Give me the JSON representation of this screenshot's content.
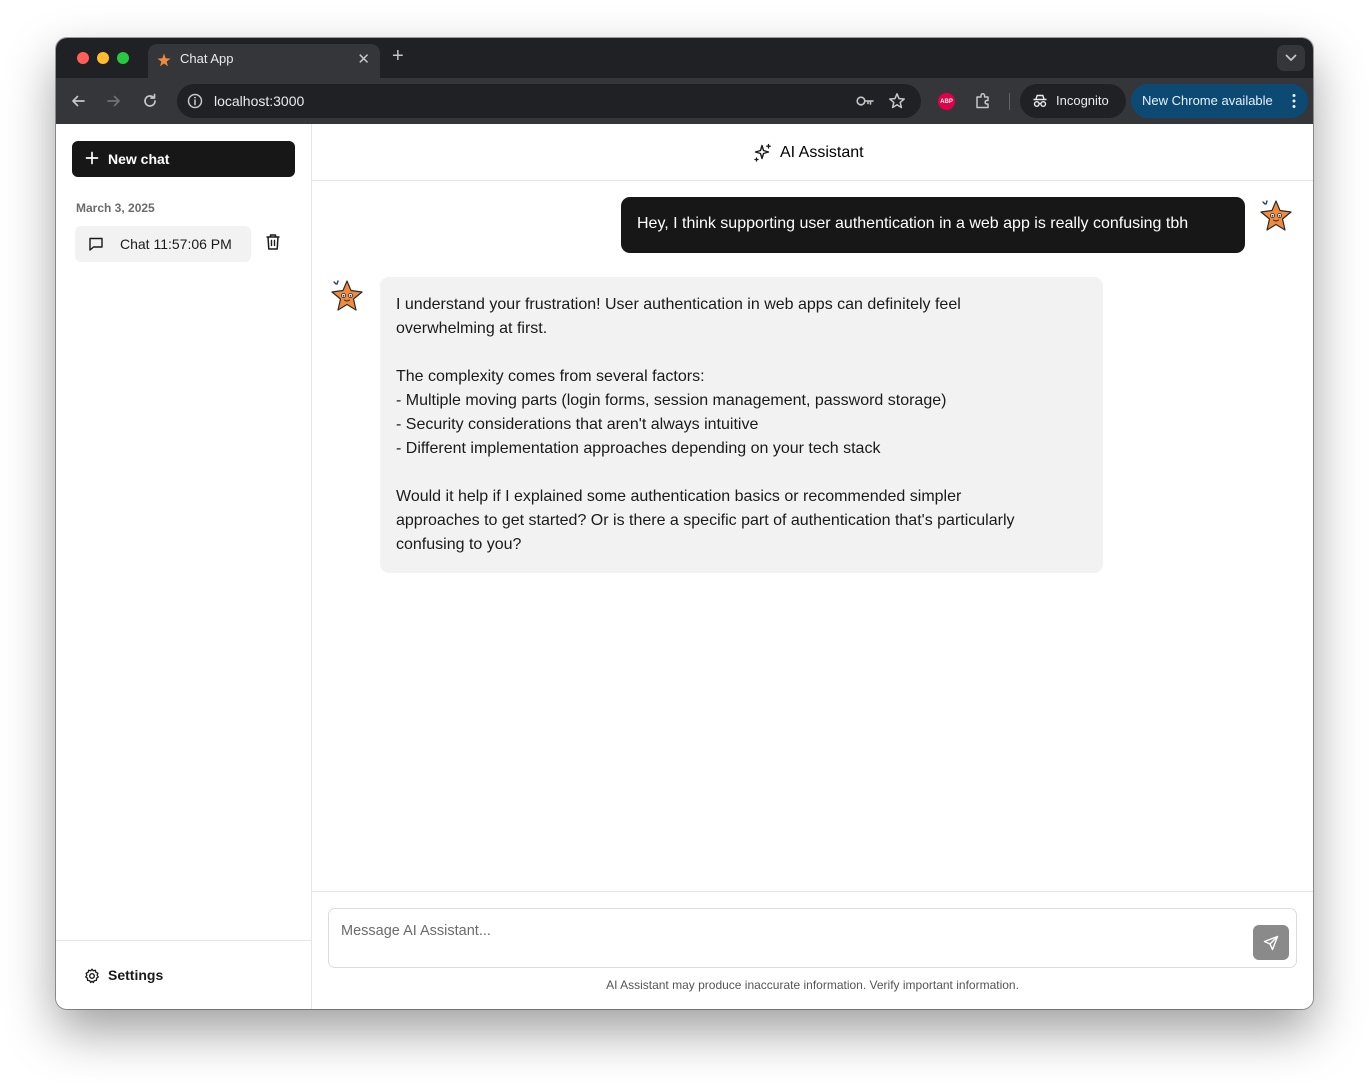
{
  "browser": {
    "tab_title": "Chat App",
    "url": "localhost:3000",
    "incognito_label": "Incognito",
    "update_label": "New Chrome available",
    "extension_abp": "ABP"
  },
  "sidebar": {
    "new_chat_label": "New chat",
    "date_group": "March 3, 2025",
    "chats": [
      {
        "label": "Chat 11:57:06 PM"
      }
    ],
    "settings_label": "Settings"
  },
  "header": {
    "title": "AI Assistant"
  },
  "messages": {
    "user_message": "Hey, I think supporting user authentication in a web app is really confusing tbh",
    "assistant_lines": [
      "I understand your frustration! User authentication in web apps can definitely feel",
      "overwhelming at first.",
      "The complexity comes from several factors:",
      "- Multiple moving parts (login forms, session management, password storage)",
      "- Security considerations that aren't always intuitive",
      "- Different implementation approaches depending on your tech stack",
      "Would it help if I explained some authentication basics or recommended simpler",
      "approaches to get started? Or is there a specific part of authentication that's particularly",
      "confusing to you?"
    ]
  },
  "composer": {
    "placeholder": "Message AI Assistant...",
    "disclaimer": "AI Assistant may produce inaccurate information. Verify important information."
  },
  "colors": {
    "primary": "#171717",
    "assistant_bubble": "#f2f2f2",
    "update_pill": "#0c4a73",
    "avatar_orange": "#f08a3c"
  }
}
